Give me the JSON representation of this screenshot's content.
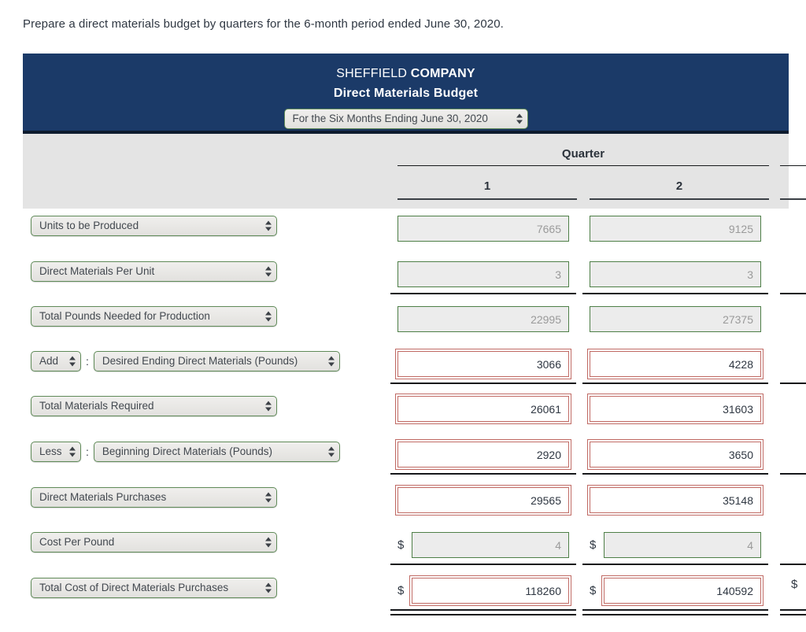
{
  "instruction": "Prepare a direct materials budget by quarters for the 6-month period ended June 30, 2020.",
  "header": {
    "company_plain": "SHEFFIELD ",
    "company_bold": "COMPANY",
    "statement_title": "Direct Materials Budget",
    "period_select": "For the Six Months Ending June 30, 2020"
  },
  "columns": {
    "group_label": "Quarter",
    "headers": [
      "1",
      "2"
    ]
  },
  "currency_symbol": "$",
  "colon": ":",
  "rows": [
    {
      "prefix": null,
      "label": "Units to be Produced",
      "q1": "7665",
      "q2": "9125",
      "kind": "calc",
      "money": false
    },
    {
      "prefix": null,
      "label": "Direct Materials Per Unit",
      "q1": "3",
      "q2": "3",
      "kind": "calc",
      "money": false
    },
    {
      "prefix": null,
      "label": "Total Pounds Needed for Production",
      "q1": "22995",
      "q2": "27375",
      "kind": "calc",
      "money": false
    },
    {
      "prefix": "Add",
      "label": "Desired Ending Direct Materials (Pounds)",
      "q1": "3066",
      "q2": "4228",
      "kind": "entry",
      "money": false
    },
    {
      "prefix": null,
      "label": "Total Materials Required",
      "q1": "26061",
      "q2": "31603",
      "kind": "entry",
      "money": false
    },
    {
      "prefix": "Less",
      "label": "Beginning Direct Materials (Pounds)",
      "q1": "2920",
      "q2": "3650",
      "kind": "entry",
      "money": false
    },
    {
      "prefix": null,
      "label": "Direct Materials Purchases",
      "q1": "29565",
      "q2": "35148",
      "kind": "entry",
      "money": false
    },
    {
      "prefix": null,
      "label": "Cost Per Pound",
      "q1": "4",
      "q2": "4",
      "kind": "calc",
      "money": true
    },
    {
      "prefix": null,
      "label": "Total Cost of Direct Materials Purchases",
      "q1": "118260",
      "q2": "140592",
      "kind": "entry",
      "money": true
    }
  ],
  "colors": {
    "header_blue": "#1b3a68",
    "header_rule": "#0d1b2e",
    "band_grey": "#e4e4e4",
    "calc_border_green": "#4e7f47",
    "entry_border_red": "#c06a64",
    "text_dark": "#2f3742"
  }
}
